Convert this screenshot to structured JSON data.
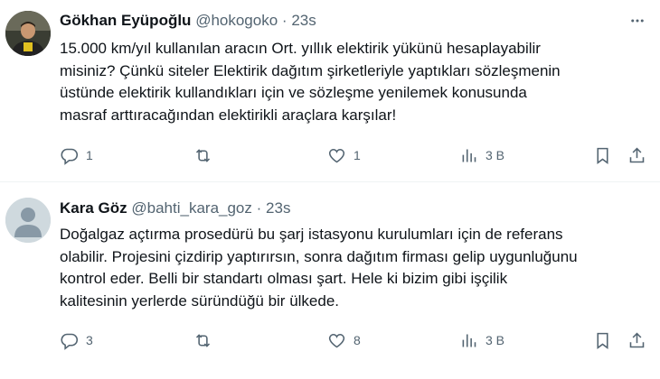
{
  "tweets": [
    {
      "name": "Gökhan Eyüpoğlu",
      "handle": "@hokogoko",
      "separator": "·",
      "time": "23s",
      "lines": [
        "15.000 km/yıl kullanılan aracın Ort. yıllık elektirik yükünü hesaplayabilir",
        "misiniz? Çünkü siteler Elektirik dağıtım şirketleriyle yaptıkları sözleşmenin",
        "üstünde elektirik kullandıkları için ve sözleşme yenilemek konusunda",
        "masraf arttıracağından elektirikli araçlara karşılar!"
      ],
      "replies": "1",
      "retweets": "",
      "likes": "1",
      "views": "3 B"
    },
    {
      "name": "Kara Göz",
      "handle": "@bahti_kara_goz",
      "separator": "·",
      "time": "23s",
      "lines": [
        "Doğalgaz açtırma prosedürü bu şarj istasyonu kurulumları için de referans",
        "olabilir. Projesini çizdirip yaptırırsın, sonra dağıtım firması gelip uygunluğunu",
        "kontrol eder. Belli bir standartı olması şart. Hele ki bizim gibi işçilik",
        "kalitesinin yerlerde süründüğü bir ülkede."
      ],
      "replies": "3",
      "retweets": "",
      "likes": "8",
      "views": "3 B"
    }
  ],
  "icons": {
    "more": "more-dots-icon",
    "reply": "reply-bubble-icon",
    "retweet": "retweet-arrows-icon",
    "like": "heart-icon",
    "views": "views-bars-icon",
    "bookmark": "bookmark-icon",
    "share": "share-upload-icon"
  },
  "colors": {
    "text": "#0f1419",
    "secondary": "#536471",
    "divider": "#eff3f4"
  }
}
